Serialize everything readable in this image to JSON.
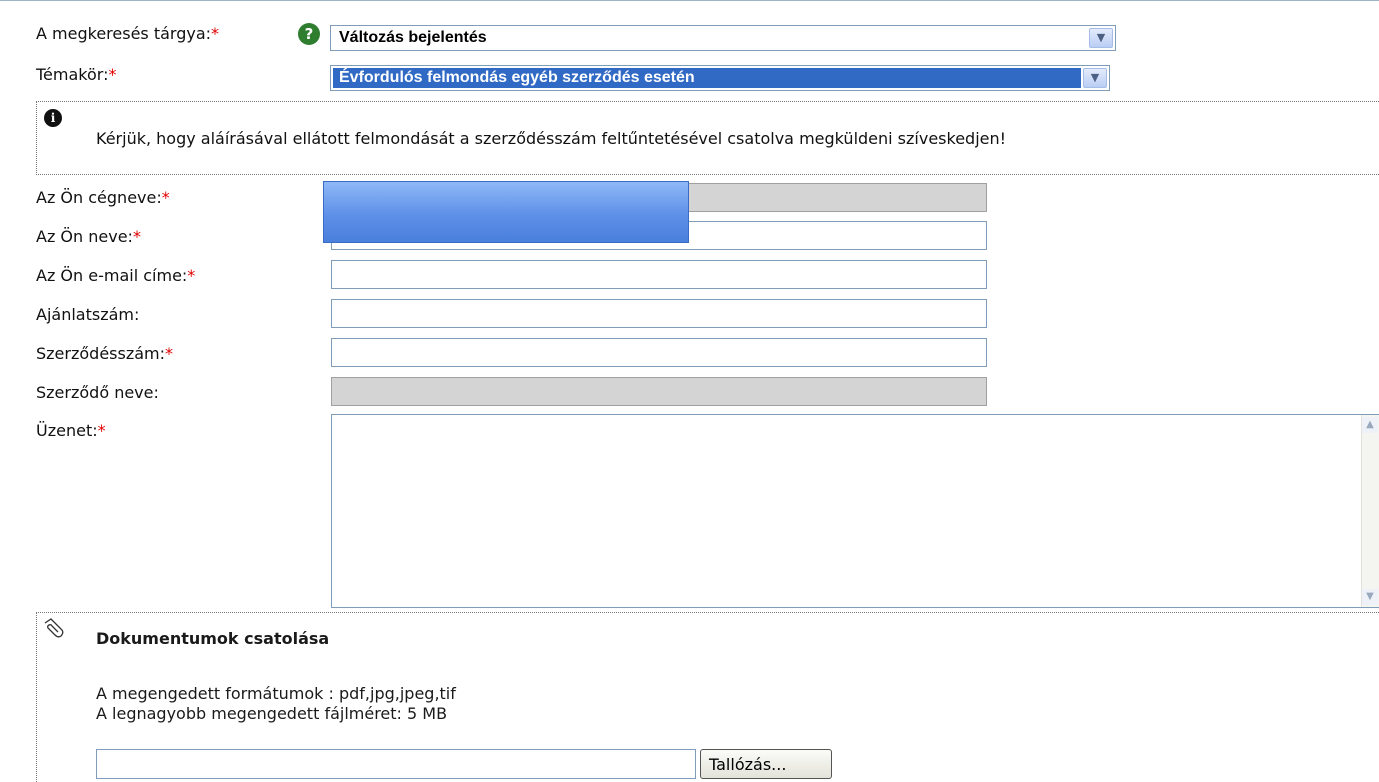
{
  "form": {
    "subject": {
      "label": "A megkeresés tárgya:",
      "required": "*",
      "help_icon": "question-icon",
      "help_glyph": "?",
      "value": "Változás bejelentés"
    },
    "topic": {
      "label": "Témakör:",
      "required": "*",
      "value": "Évfordulós felmondás egyéb szerződés esetén"
    },
    "info": {
      "icon": "info-icon",
      "icon_glyph": "i",
      "text": "Kérjük, hogy aláírásával ellátott felmondását a szerződésszám feltűntetésével csatolva megküldeni szíveskedjen!"
    },
    "fields": [
      {
        "label": "Az Ön cégneve:",
        "required": "*",
        "value": "",
        "disabled": true
      },
      {
        "label": "Az Ön neve:",
        "required": "*",
        "value": "",
        "disabled": false
      },
      {
        "label": "Az Ön e-mail címe:",
        "required": "*",
        "value": "",
        "disabled": false
      },
      {
        "label": "Ajánlatszám:",
        "required": "",
        "value": "",
        "disabled": false
      },
      {
        "label": "Szerződésszám:",
        "required": "*",
        "value": "",
        "disabled": false
      },
      {
        "label": "Szerződő neve:",
        "required": "",
        "value": "",
        "disabled": true
      }
    ],
    "message": {
      "label": "Üzenet:",
      "required": "*",
      "value": ""
    }
  },
  "attachments": {
    "icon": "paperclip-icon",
    "title": "Dokumentumok csatolása",
    "formats": "A megengedett formátumok : pdf,jpg,jpeg,tif",
    "max_size": "A legnagyobb megengedett fájlméret: 5 MB",
    "browse_label": "Tallózás..."
  },
  "colors": {
    "required": "#e00000",
    "selection": "#316ac5",
    "redaction": "#5e90e8"
  }
}
